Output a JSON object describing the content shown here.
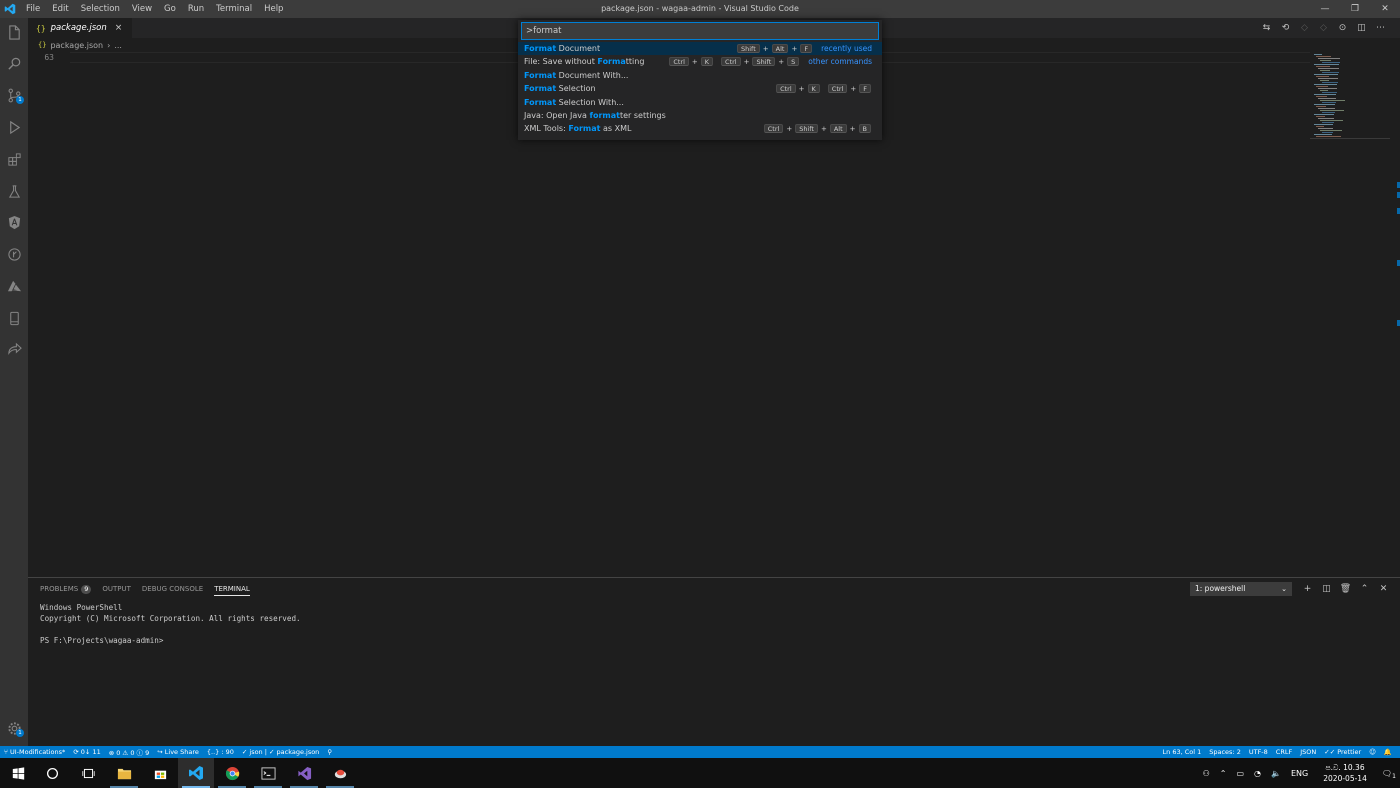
{
  "window": {
    "title": "package.json - wagaa-admin - Visual Studio Code",
    "menu": [
      "File",
      "Edit",
      "Selection",
      "View",
      "Go",
      "Run",
      "Terminal",
      "Help"
    ]
  },
  "tab": {
    "name": "package.json",
    "close": "×"
  },
  "breadcrumb": {
    "file": "package.json",
    "sep": "›",
    "more": "..."
  },
  "editor": {
    "line_number": "63"
  },
  "command_palette": {
    "input_value": ">format",
    "items": [
      {
        "pre": "",
        "hl": "Format",
        "post": " Document",
        "keys": [
          "Shift",
          "Alt",
          "F"
        ],
        "kind": "recently used",
        "selected": true
      },
      {
        "pre": "File: Save without ",
        "hl": "Forma",
        "post": "tting",
        "chords": [
          [
            "Ctrl",
            "K"
          ],
          [
            "Ctrl",
            "Shift",
            "S"
          ]
        ],
        "kind": "other commands"
      },
      {
        "pre": "",
        "hl": "Format",
        "post": " Document With...",
        "keys": [],
        "kind": ""
      },
      {
        "pre": "",
        "hl": "Format",
        "post": " Selection",
        "chords": [
          [
            "Ctrl",
            "K"
          ],
          [
            "Ctrl",
            "F"
          ]
        ],
        "kind": ""
      },
      {
        "pre": "",
        "hl": "Format",
        "post": " Selection With...",
        "keys": [],
        "kind": ""
      },
      {
        "pre": "Java: Open Java ",
        "hl": "format",
        "post": "ter settings",
        "keys": [],
        "kind": ""
      },
      {
        "pre": "XML Tools: ",
        "hl": "Format",
        "post": " as XML",
        "keys": [
          "Ctrl",
          "Shift",
          "Alt",
          "B"
        ],
        "kind": ""
      }
    ]
  },
  "panel": {
    "tabs": [
      {
        "label": "PROBLEMS",
        "badge": "9"
      },
      {
        "label": "OUTPUT"
      },
      {
        "label": "DEBUG CONSOLE"
      },
      {
        "label": "TERMINAL",
        "active": true
      }
    ],
    "terminal_select": "1: powershell",
    "terminal_lines": [
      "Windows PowerShell",
      "Copyright (C) Microsoft Corporation. All rights reserved.",
      "",
      "PS F:\\Projects\\wagaa-admin>"
    ]
  },
  "statusbar": {
    "branch": "UI-Modifications*",
    "sync": "0↓ 11",
    "problems": "⊗ 0 ⚠ 0 ⓘ 9",
    "liveshare": "Live Share",
    "cursor_sel": "{..} : 90",
    "json_check": "✓ json | ✓ package.json",
    "pin": "⚲",
    "position": "Ln 63, Col 1",
    "spaces": "Spaces: 2",
    "encoding": "UTF-8",
    "eol": "CRLF",
    "language": "JSON",
    "formatter": "✓✓ Prettier",
    "feedback": "☺",
    "bell": "🔔"
  },
  "taskbar": {
    "lang": "ENG",
    "time": "ප.ව. 10.36",
    "date": "2020-05-14",
    "notifications": "1"
  },
  "colors": {
    "accent": "#007acc",
    "highlight": "#0097fb",
    "selected_row": "#062f4a"
  }
}
